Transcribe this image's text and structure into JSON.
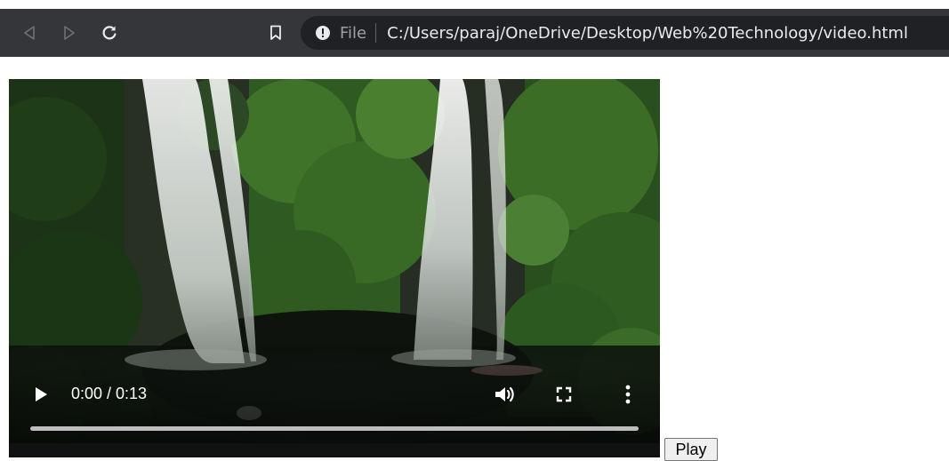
{
  "browser": {
    "back_icon": "back-triangle-icon",
    "forward_icon": "forward-triangle-icon",
    "reload_icon": "reload-icon",
    "bookmark_icon": "bookmark-icon",
    "info_icon": "info-icon",
    "scheme_label": "File",
    "url": "C:/Users/paraj/OneDrive/Desktop/Web%20Technology/video.html",
    "colors": {
      "toolbar": "#35363a",
      "omnibox": "#202124",
      "url_text": "#e8eaed",
      "muted_text": "#9aa0a6"
    }
  },
  "video": {
    "poster": "waterfall-scene",
    "current_time": "0:00",
    "duration": "0:13",
    "time_display": "0:00 / 0:13",
    "progress": 0.0,
    "icons": {
      "play": "play-icon",
      "volume": "volume-icon",
      "fullscreen": "fullscreen-icon",
      "more": "more-options-icon"
    }
  },
  "page": {
    "play_button_label": "Play"
  }
}
